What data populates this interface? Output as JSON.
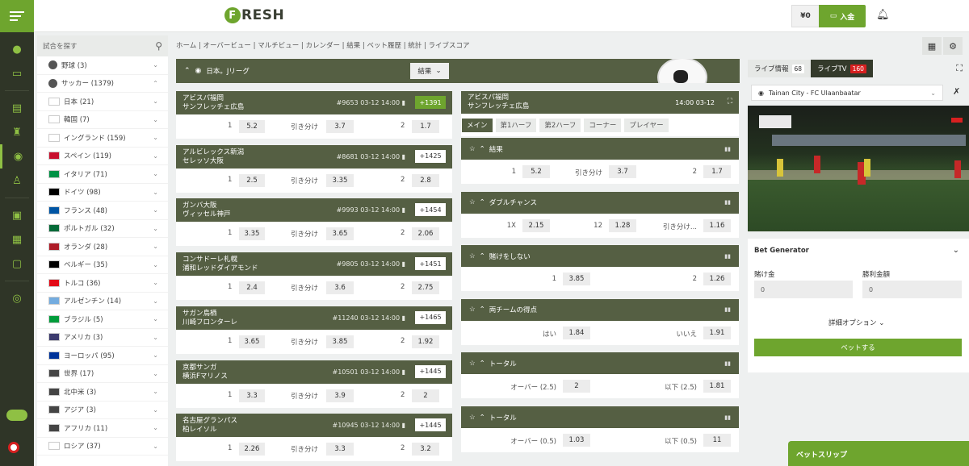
{
  "nav": {
    "icons": [
      "menu-icon",
      "user-icon",
      "wallet-icon",
      "odds-icon",
      "trophy-icon",
      "soccer-icon",
      "fight-icon",
      "gift-icon",
      "calendar-icon",
      "chat-icon",
      "support-icon",
      "toggle-icon",
      "flag-icon"
    ]
  },
  "header": {
    "logo_f": "F",
    "logo_rest": "RESH",
    "balance": "¥0",
    "deposit": "入金"
  },
  "sidebar": {
    "search_placeholder": "試合を探す",
    "items": [
      {
        "label": "野球 (3)",
        "kind": "sport"
      },
      {
        "label": "サッカー (1379)",
        "kind": "sport",
        "open": true
      },
      {
        "label": "日本 (21)",
        "kind": "country",
        "flag": "#ffffff"
      },
      {
        "label": "韓国 (7)",
        "kind": "country",
        "flag": "#ffffff"
      },
      {
        "label": "イングランド (159)",
        "kind": "country",
        "flag": "#ffffff"
      },
      {
        "label": "スペイン (119)",
        "kind": "country",
        "flag": "#c8102e"
      },
      {
        "label": "イタリア (71)",
        "kind": "country",
        "flag": "#009246"
      },
      {
        "label": "ドイツ (98)",
        "kind": "country",
        "flag": "#000000"
      },
      {
        "label": "フランス (48)",
        "kind": "country",
        "flag": "#0055a4"
      },
      {
        "label": "ポルトガル (32)",
        "kind": "country",
        "flag": "#046a38"
      },
      {
        "label": "オランダ (28)",
        "kind": "country",
        "flag": "#ae1c28"
      },
      {
        "label": "ベルギー (35)",
        "kind": "country",
        "flag": "#000000"
      },
      {
        "label": "トルコ (36)",
        "kind": "country",
        "flag": "#e30a17"
      },
      {
        "label": "アルゼンチン (14)",
        "kind": "country",
        "flag": "#74acdf"
      },
      {
        "label": "ブラジル (5)",
        "kind": "country",
        "flag": "#009c3b"
      },
      {
        "label": "アメリカ (3)",
        "kind": "country",
        "flag": "#3c3b6e"
      },
      {
        "label": "ヨーロッパ (95)",
        "kind": "country",
        "flag": "#003399"
      },
      {
        "label": "世界 (17)",
        "kind": "country",
        "flag": "#444444"
      },
      {
        "label": "北中米 (3)",
        "kind": "country",
        "flag": "#444444"
      },
      {
        "label": "アジア (3)",
        "kind": "country",
        "flag": "#444444"
      },
      {
        "label": "アフリカ (11)",
        "kind": "country",
        "flag": "#444444"
      },
      {
        "label": "ロシア (37)",
        "kind": "country",
        "flag": "#ffffff"
      }
    ]
  },
  "breadcrumb": "ホーム | オーバービュー | マルチビュー | カレンダー | 結果 | ベット履歴 | 統計 | ライブスコア",
  "league": {
    "title": "日本。Jリーグ",
    "select": "結果"
  },
  "matches": [
    {
      "home": "アビスパ福岡",
      "away": "サンフレッチェ広島",
      "id": "#9653",
      "date": "03-12",
      "time": "14:00",
      "count": "+1391",
      "green": true,
      "o1": "5.2",
      "ox": "3.7",
      "o2": "1.7"
    },
    {
      "home": "アルビレックス新潟",
      "away": "セレッソ大阪",
      "id": "#8681",
      "date": "03-12",
      "time": "14:00",
      "count": "+1425",
      "green": false,
      "o1": "2.5",
      "ox": "3.35",
      "o2": "2.8"
    },
    {
      "home": "ガンバ大阪",
      "away": "ヴィッセル神戸",
      "id": "#9993",
      "date": "03-12",
      "time": "14:00",
      "count": "+1454",
      "green": false,
      "o1": "3.35",
      "ox": "3.65",
      "o2": "2.06"
    },
    {
      "home": "コンサドーレ札幌",
      "away": "浦和レッドダイアモンド",
      "id": "#9805",
      "date": "03-12",
      "time": "14:00",
      "count": "+1451",
      "green": false,
      "o1": "2.4",
      "ox": "3.6",
      "o2": "2.75"
    },
    {
      "home": "サガン鳥栖",
      "away": "川崎フロンターレ",
      "id": "#11240",
      "date": "03-12",
      "time": "14:00",
      "count": "+1465",
      "green": false,
      "o1": "3.65",
      "ox": "3.85",
      "o2": "1.92"
    },
    {
      "home": "京都サンガ",
      "away": "横浜Fマリノス",
      "id": "#10501",
      "date": "03-12",
      "time": "14:00",
      "count": "+1445",
      "green": false,
      "o1": "3.3",
      "ox": "3.9",
      "o2": "2"
    },
    {
      "home": "名古屋グランパス",
      "away": "柏レイソル",
      "id": "#10945",
      "date": "03-12",
      "time": "14:00",
      "count": "+1445",
      "green": false,
      "o1": "2.26",
      "ox": "3.3",
      "o2": "3.2"
    }
  ],
  "labels": {
    "one": "1",
    "draw": "引き分け",
    "two": "2"
  },
  "detail": {
    "home": "アビスパ福岡",
    "away": "サンフレッチェ広島",
    "time": "14:00",
    "date": "03-12",
    "tabs": [
      "メイン",
      "第1ハーフ",
      "第2ハーフ",
      "コーナー",
      "プレイヤー"
    ]
  },
  "markets": [
    {
      "title": "結果",
      "cells": [
        {
          "l": "1",
          "v": "5.2"
        },
        {
          "l": "引き分け",
          "v": "3.7"
        },
        {
          "l": "2",
          "v": "1.7"
        }
      ]
    },
    {
      "title": "ダブルチャンス",
      "cells": [
        {
          "l": "1X",
          "v": "2.15"
        },
        {
          "l": "12",
          "v": "1.28"
        },
        {
          "l": "引き分け...",
          "v": "1.16"
        }
      ]
    },
    {
      "title": "賭けをしない",
      "cells": [
        {
          "l": "1",
          "v": "3.85"
        },
        {
          "l": "2",
          "v": "1.26"
        }
      ]
    },
    {
      "title": "両チームの得点",
      "cells": [
        {
          "l": "はい",
          "v": "1.84"
        },
        {
          "l": "いいえ",
          "v": "1.91"
        }
      ]
    },
    {
      "title": "トータル",
      "cells": [
        {
          "l": "オーバー (2.5)",
          "v": "2"
        },
        {
          "l": "以下 (2.5)",
          "v": "1.81"
        }
      ]
    },
    {
      "title": "トータル",
      "cells": [
        {
          "l": "オーバー (0.5)",
          "v": "1.03"
        },
        {
          "l": "以下 (0.5)",
          "v": "11"
        }
      ]
    }
  ],
  "right": {
    "tab1": "ライブ情報",
    "tab1_count": "68",
    "tab2": "ライブTV",
    "tab2_count": "160",
    "match": "Tainan City - FC Ulaanbaatar"
  },
  "betgen": {
    "title": "Bet Generator",
    "stake_label": "賭け金",
    "win_label": "勝利金額",
    "stake": "0",
    "win": "0",
    "options": "詳細オプション",
    "bet": "ベットする"
  },
  "betslip": "ベットスリップ",
  "colors": {
    "accent": "#6ea52e",
    "header_bar": "#555f43",
    "rail": "#2f3527",
    "live_red": "#d72020"
  }
}
